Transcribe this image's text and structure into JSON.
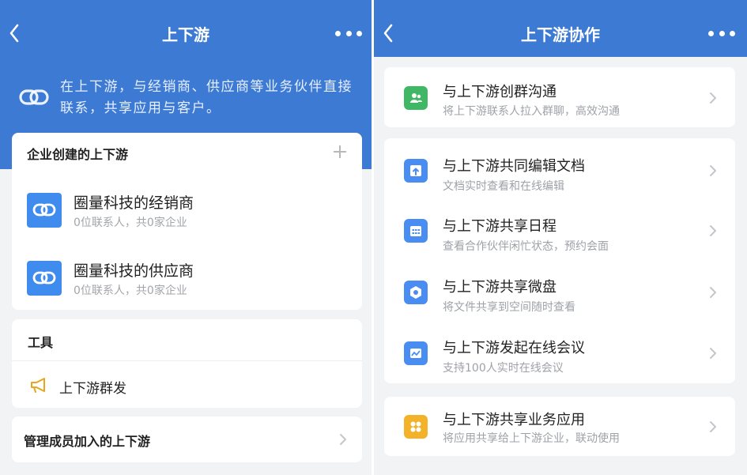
{
  "left_screen": {
    "nav": {
      "title": "上下游"
    },
    "intro": {
      "text": "在上下游，与经销商、供应商等业务伙伴直接联系，共享应用与客户。"
    },
    "enterprise_section": {
      "header": "企业创建的上下游",
      "items": [
        {
          "name": "圈量科技的经销商",
          "subtitle": "0位联系人，共0家企业"
        },
        {
          "name": "圈量科技的供应商",
          "subtitle": "0位联系人，共0家企业"
        }
      ]
    },
    "tools": {
      "title": "工具",
      "broadcast_label": "上下游群发"
    },
    "manage": {
      "label": "管理成员加入的上下游"
    }
  },
  "right_screen": {
    "nav": {
      "title": "上下游协作"
    },
    "features": [
      {
        "title": "与上下游创群沟通",
        "subtitle": "将上下游联系人拉入群聊，高效沟通",
        "icon": "group-chat-icon",
        "color": "#3fb764"
      },
      {
        "title": "与上下游共同编辑文档",
        "subtitle": "文档实时查看和在线编辑",
        "icon": "document-icon",
        "color": "#4a8df2"
      },
      {
        "title": "与上下游共享日程",
        "subtitle": "查看合作伙伴闲忙状态，预约会面",
        "icon": "calendar-icon",
        "color": "#4a8df2"
      },
      {
        "title": "与上下游共享微盘",
        "subtitle": "将文件共享到空间随时查看",
        "icon": "cloud-drive-icon",
        "color": "#4a8df2"
      },
      {
        "title": "与上下游发起在线会议",
        "subtitle": "支持100人实时在线会议",
        "icon": "meeting-icon",
        "color": "#4a8df2"
      },
      {
        "title": "与上下游共享业务应用",
        "subtitle": "将应用共享给上下游企业，联动使用",
        "icon": "apps-icon",
        "color": "#f2b32a"
      }
    ]
  },
  "colors": {
    "nav_blue": "#3d7ad3",
    "party_icon_blue": "#3f8bee",
    "page_background": "#f2f3f5"
  }
}
